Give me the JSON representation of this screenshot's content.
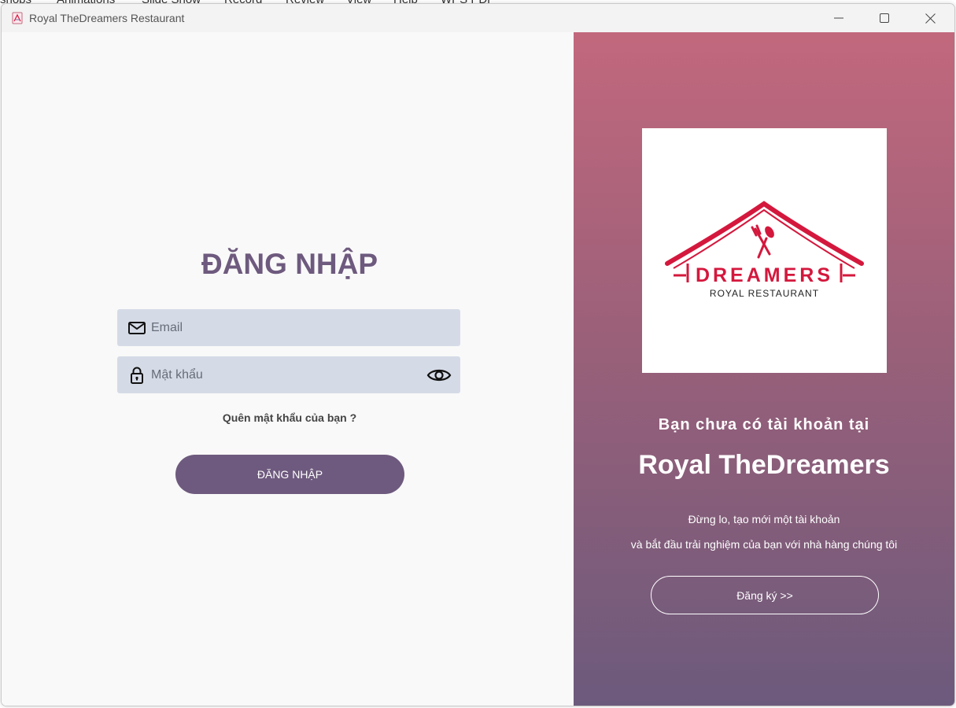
{
  "background_app": {
    "menu_items": [
      "shops",
      "Animations",
      "Slide Show",
      "Record",
      "Review",
      "View",
      "Help",
      "WPS PDF"
    ]
  },
  "window": {
    "title": "Royal TheDreamers Restaurant",
    "icon": "restaurant-app-icon",
    "controls": {
      "minimize_icon": "minimize-icon",
      "maximize_icon": "maximize-icon",
      "close_icon": "close-icon"
    }
  },
  "login": {
    "title": "ĐĂNG NHẬP",
    "email": {
      "placeholder": "Email",
      "value": "",
      "icon": "mail-icon"
    },
    "password": {
      "placeholder": "Mật khẩu",
      "value": "",
      "icon": "lock-icon",
      "toggle_icon": "eye-icon"
    },
    "forgot_password": "Quên mật khẩu của bạn ?",
    "submit_label": "ĐĂNG NHẬP"
  },
  "promo": {
    "logo": {
      "brand_text": "DREAMERS",
      "tagline": "ROYAL RESTAURANT"
    },
    "line1": "Bạn chưa có tài khoản tại",
    "brand": "Royal TheDreamers",
    "sub1": "Đừng lo, tạo mới một tài khoản",
    "sub2": "và bắt đầu trải nghiệm của bạn với nhà hàng chúng tôi",
    "register_label": "Đăng ký  >>"
  },
  "colors": {
    "accent": "#6e5a7e",
    "field_bg": "#d5dbe6",
    "gradient_top": "#c2687d",
    "gradient_bottom": "#6c5a7c",
    "logo_red": "#d4183d"
  }
}
